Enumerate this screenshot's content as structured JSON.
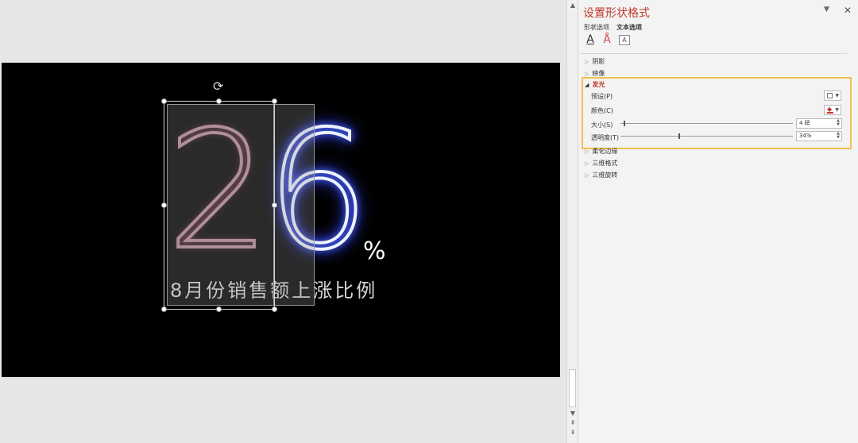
{
  "slide": {
    "digit_left": "2",
    "digit_right": "6",
    "percent_sign": "%",
    "subtitle": "8月份销售额上涨比例",
    "glow_left_color": "#b98d9a",
    "glow_right_color": "#3340ff"
  },
  "panel": {
    "title": "设置形状格式",
    "tabs": [
      "形状选项",
      "文本选项"
    ],
    "active_tab": "文本选项",
    "tool_icons": [
      "text-fill-icon",
      "text-outline-icon",
      "text-box-icon"
    ],
    "sections": {
      "shadow": "阴影",
      "reflection": "映像",
      "glow": "发光",
      "soft_edges": "柔化边缘",
      "format_3d": "三维格式",
      "rotation_3d": "三维旋转"
    },
    "glow": {
      "preset_label": "预设(P)",
      "color_label": "颜色(C)",
      "size_label": "大小(S)",
      "size_value": "4 磅",
      "transparency_label": "透明度(T)",
      "transparency_value": "34%",
      "highlight_color": "#f2c14b"
    }
  }
}
